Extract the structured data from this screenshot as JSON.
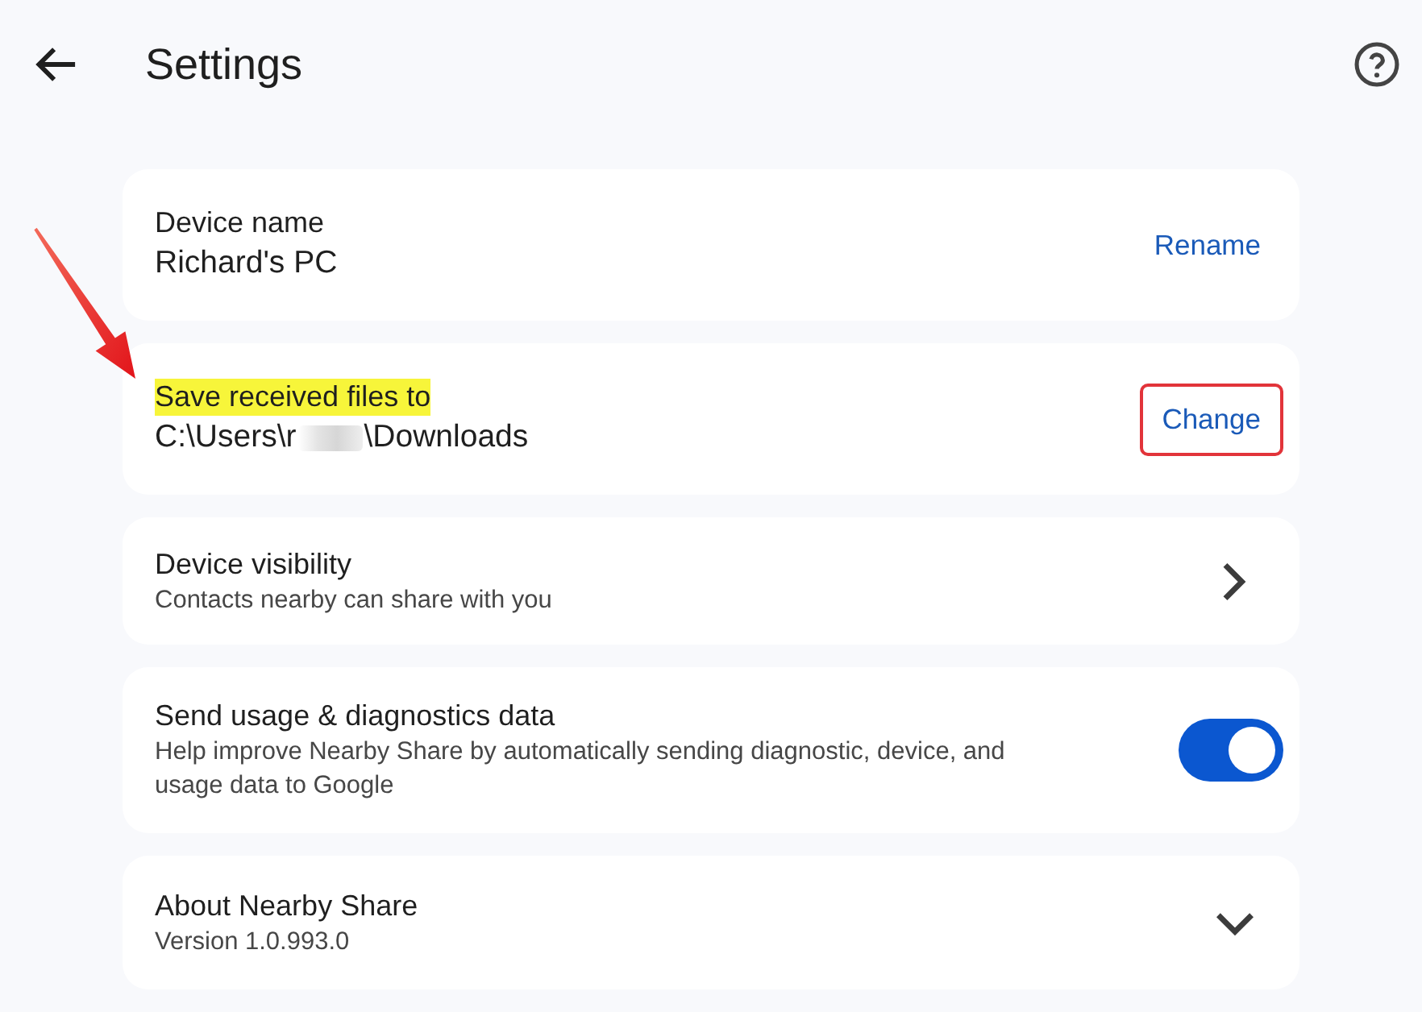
{
  "header": {
    "title": "Settings"
  },
  "callout_arrow": true,
  "rows": [
    {
      "kind": "action",
      "title": "Device name",
      "highlighted": false,
      "value": "Richard's PC",
      "action": "Rename",
      "action_outlined": false
    },
    {
      "kind": "action",
      "title": "Save received files to",
      "highlighted": true,
      "value": "C:\\Users\\r",
      "value_after_redaction": "\\Downloads",
      "action": "Change",
      "action_outlined": true
    },
    {
      "kind": "link",
      "title": "Device visibility",
      "highlighted": false,
      "description": "Contacts nearby can share with you"
    },
    {
      "kind": "toggle",
      "title": "Send usage & diagnostics data",
      "highlighted": false,
      "description": "Help improve Nearby Share by automatically sending diagnostic, device, and usage data to Google",
      "on": true
    },
    {
      "kind": "expand",
      "title": "About Nearby Share",
      "highlighted": false,
      "description": "Version 1.0.993.0",
      "expanded": false
    }
  ]
}
